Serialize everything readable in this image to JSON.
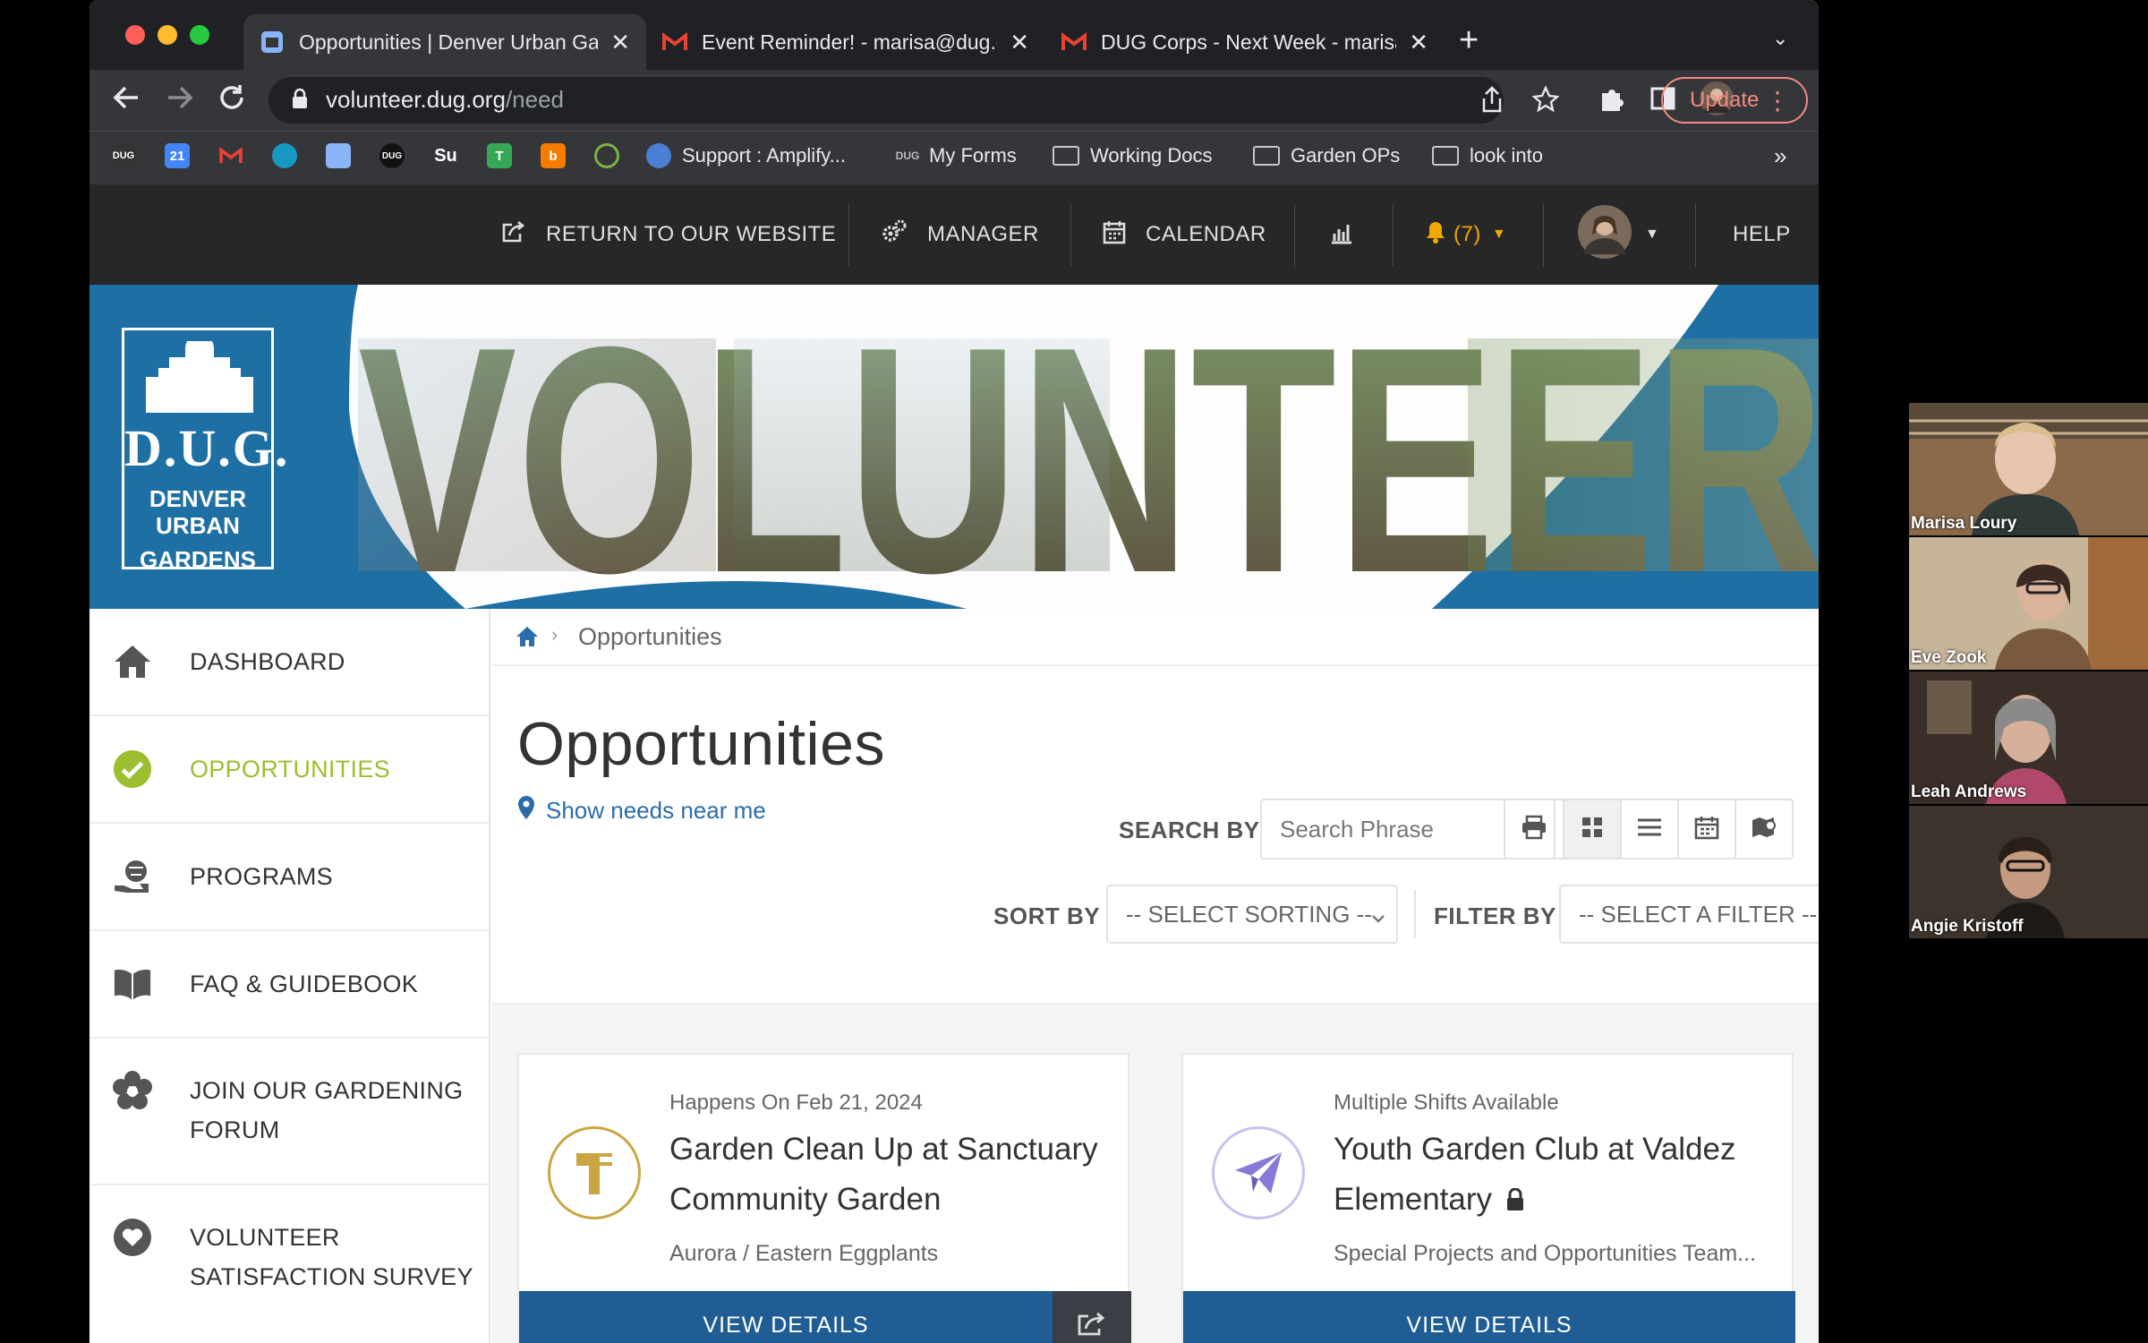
{
  "browser": {
    "tabs": [
      {
        "label": "Opportunities | Denver Urban Gardens",
        "active": true,
        "icon": "dug-favicon"
      },
      {
        "label": "Event Reminder! - marisa@dug.org",
        "active": false,
        "icon": "gmail-icon"
      },
      {
        "label": "DUG Corps - Next Week - marisa@dug.org",
        "active": false,
        "icon": "gmail-icon"
      }
    ],
    "url_host": "volunteer.dug.org",
    "url_path": "/need",
    "update_label": "Update",
    "bookmarks": [
      {
        "label": "Support : Amplify...",
        "icon": "globe-icon"
      },
      {
        "label": "My Forms",
        "icon": "form-icon"
      },
      {
        "label": "Working Docs",
        "icon": "folder-icon"
      },
      {
        "label": "Garden OPs",
        "icon": "folder-icon"
      },
      {
        "label": "look into",
        "icon": "folder-icon"
      }
    ],
    "bookmark_overflow": "»"
  },
  "site_nav": {
    "return_label": "RETURN TO OUR WEBSITE",
    "manager_label": "MANAGER",
    "calendar_label": "CALENDAR",
    "notifications_label": "(7)",
    "help_label": "HELP"
  },
  "logo": {
    "line1": "D.U.G.",
    "line2": "DENVER URBAN",
    "line3": "GARDENS"
  },
  "banner_word": "VOLUNTEER",
  "sidebar": {
    "items": [
      {
        "label": "DASHBOARD",
        "icon": "home-icon",
        "active": false
      },
      {
        "label": "OPPORTUNITIES",
        "icon": "check-circle-icon",
        "active": true
      },
      {
        "label": "PROGRAMS",
        "icon": "hand-globe-icon",
        "active": false
      },
      {
        "label": "FAQ & GUIDEBOOK",
        "icon": "book-icon",
        "active": false
      },
      {
        "label": "JOIN OUR GARDENING FORUM",
        "label_line1": "JOIN OUR GARDENING",
        "label_line2": "FORUM",
        "icon": "flower-icon",
        "active": false
      },
      {
        "label": "VOLUNTEER SATISFACTION SURVEY",
        "label_line1": "VOLUNTEER",
        "label_line2": "SATISFACTION SURVEY",
        "icon": "heart-icon",
        "active": false
      }
    ]
  },
  "breadcrumb": {
    "current": "Opportunities"
  },
  "page": {
    "title": "Opportunities",
    "near_link": "Show needs near me",
    "search_by_label": "SEARCH BY",
    "search_placeholder": "Search Phrase",
    "sort_by_label": "SORT BY",
    "sort_value": "-- SELECT SORTING --",
    "filter_by_label": "FILTER BY",
    "filter_value": "-- SELECT A FILTER --"
  },
  "cards": [
    {
      "meta": "Happens On Feb 21, 2024",
      "title": "Garden Clean Up at Sanctuary Community Garden",
      "subtitle": "Aurora / Eastern Eggplants",
      "button": "VIEW DETAILS",
      "icon": "hammer-icon",
      "icon_color": "#c9a640"
    },
    {
      "meta": "Multiple Shifts Available",
      "title": "Youth Garden Club at Valdez Elementary",
      "subtitle": "Special Projects and Opportunities Team...",
      "button": "VIEW DETAILS",
      "icon": "paper-plane-icon",
      "icon_color": "#8a78d8"
    }
  ],
  "video_participants": [
    {
      "name": "Marisa Loury"
    },
    {
      "name": "Eve Zook"
    },
    {
      "name": "Leah Andrews"
    },
    {
      "name": "Angie Kristoff"
    }
  ],
  "colors": {
    "brand_blue": "#1e6fa3",
    "active_green": "#9bbf2e",
    "button_blue": "#1f5d94",
    "nav_dark": "#272727"
  }
}
